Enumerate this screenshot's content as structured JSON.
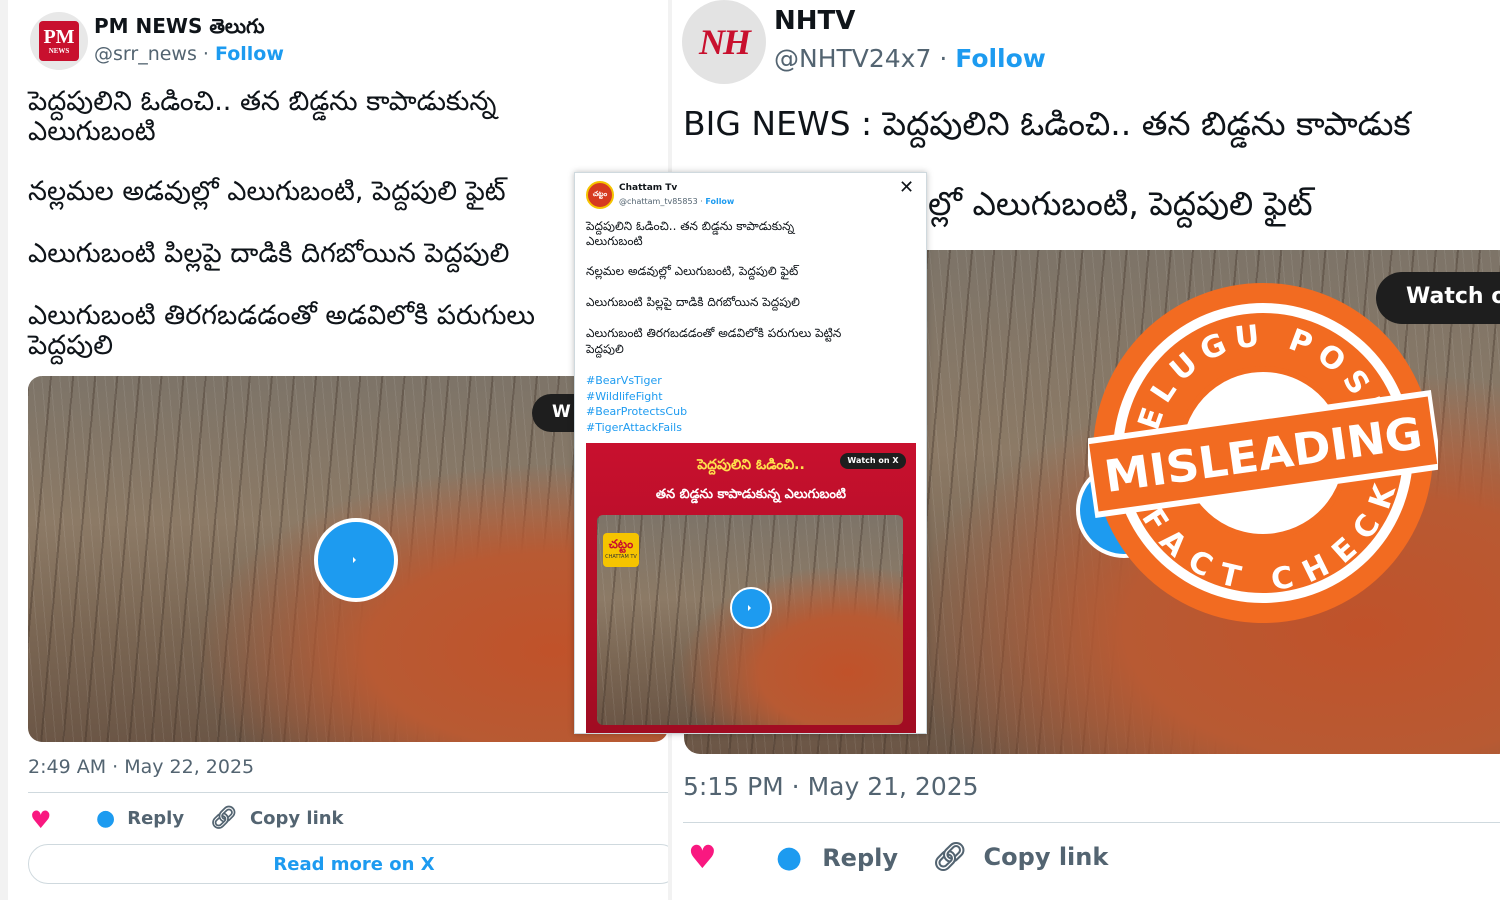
{
  "left_tweet": {
    "account_name": "PM NEWS తెలుగు",
    "handle": "@srr_news",
    "follow_label": "Follow",
    "avatar_text": "PM",
    "avatar_sub": "NEWS",
    "lines": [
      "పెద్దపులిని ఓడించి.. తన బిడ్డను కాపాడుకున్న",
      "ఎలుగుబంటి",
      "నల్లమల అడవుల్లో ఎలుగుబంటి, పెద్దపులి ఫైట్",
      "ఎలుగుబంటి పిల్లపై దాడికి దిగబోయిన పెద్దపులి",
      "ఎలుగుబంటి తిరగబడడంతో అడవిలోకి పరుగులు",
      "పెద్దపులి"
    ],
    "watch_label": "W",
    "timestamp": "2:49 AM · May 22, 2025",
    "actions": {
      "reply": "Reply",
      "copy_link": "Copy link"
    },
    "read_more": "Read more on X"
  },
  "middle_tweet": {
    "account_name": "Chattam Tv",
    "handle": "@chattam_tv85853",
    "follow_label": "Follow",
    "avatar_text": "చట్టం",
    "lines": [
      "పెద్దపులిని ఓడించి.. తన బిడ్డను కాపాడుకున్న",
      "ఎలుగుబంటి",
      "నల్లమల అడవుల్లో ఎలుగుబంటి, పెద్దపులి ఫైట్",
      "ఎలుగుబంటి పిల్లపై దాడికి దిగబోయిన పెద్దపులి",
      "ఎలుగుబంటి తిరగబడడంతో అడవిలోకి పరుగులు పెట్టిన",
      "పెద్దపులి"
    ],
    "hashtags": [
      "#BearVsTiger",
      "#WildlifeFight",
      "#BearProtectsCub",
      "#TigerAttackFails"
    ],
    "banner_line_1": "పెద్దపులిని ఓడించి..",
    "banner_line_2": "తన బిడ్డను కాపాడుకున్న ఎలుగుబంటి",
    "watch_label": "Watch on X",
    "logo_text": "చట్టం",
    "logo_sub": "CHATTAM TV"
  },
  "right_tweet": {
    "account_name": "NHTV",
    "handle": "@NHTV24x7",
    "follow_label": "Follow",
    "avatar_text": "NH",
    "line_1": "BIG NEWS : పెద్దపులిని ఓడించి.. తన బిడ్డను కాపాడుక",
    "line_2": "ల్లో ఎలుగుబంటి, పెద్దపులి ఫైట్",
    "watch_label": "Watch o",
    "timestamp": "5:15 PM · May 21, 2025",
    "actions": {
      "reply": "Reply",
      "copy_link": "Copy link"
    }
  },
  "stamp": {
    "top_text": "TELUGU POST",
    "verdict": "MISLEADING",
    "bottom_text": "FACT CHECK",
    "color": "#f26b21"
  },
  "colors": {
    "link_blue": "#1d9bf0",
    "heart_pink": "#f91880",
    "banner_red": "#c8102e"
  }
}
